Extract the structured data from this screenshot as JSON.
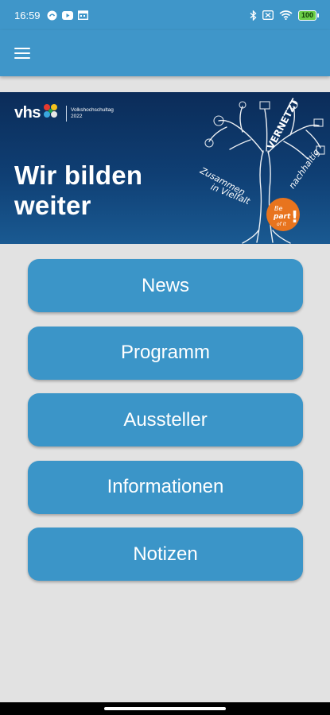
{
  "status_bar": {
    "time": "16:59",
    "left_icons": [
      "cloud-sync-icon",
      "youtube-icon",
      "calendar-icon"
    ],
    "right_icons": [
      "bluetooth-icon",
      "battery-saver-icon",
      "wifi-icon"
    ],
    "battery": "100"
  },
  "app_bar": {
    "menu_icon": "hamburger-icon"
  },
  "banner": {
    "logo": {
      "name": "vhs",
      "line1": "Volkshochschultag",
      "line2": "2022"
    },
    "title_line1": "Wir bilden",
    "title_line2": "weiter",
    "art": {
      "words": [
        "VERNETZT",
        "Zusammen",
        "in Vielfalt",
        "nachhaltig"
      ],
      "badge_line1": "Be",
      "badge_line2": "part",
      "badge_line3": "of it"
    }
  },
  "menu": {
    "items": [
      {
        "label": "News"
      },
      {
        "label": "Programm"
      },
      {
        "label": "Aussteller"
      },
      {
        "label": "Informationen"
      },
      {
        "label": "Notizen"
      }
    ]
  },
  "colors": {
    "primary": "#3f96c9",
    "button": "#3b95c8",
    "background": "#e2e2e2",
    "banner_dark": "#0b2c59",
    "badge_orange": "#e8741e"
  }
}
